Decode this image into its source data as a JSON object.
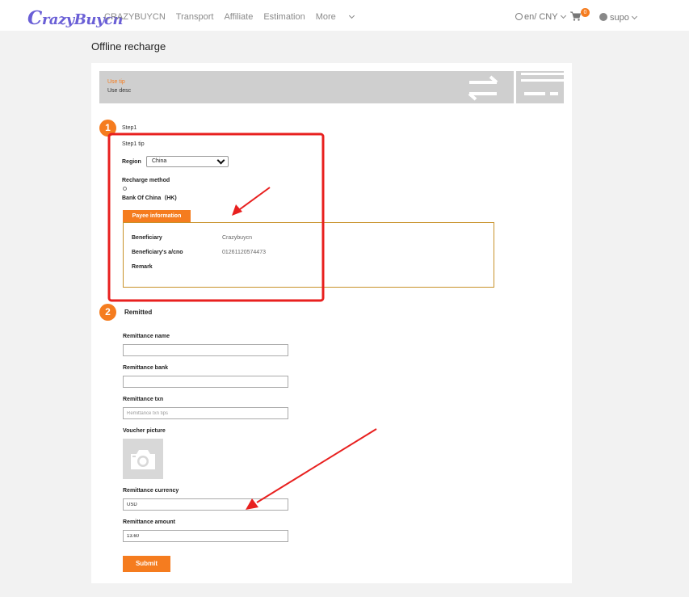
{
  "header": {
    "logo_initial": "C",
    "logo_rest": "razyBuycn",
    "nav": [
      "CRAZYBUYCN",
      "Transport",
      "Affiliate",
      "Estimation",
      "More"
    ],
    "lang": "en/ CNY",
    "cart_count": "0",
    "user": "supo"
  },
  "page_title": "Offline recharge",
  "tip": {
    "title": "Use tip",
    "desc": "Use desc"
  },
  "step1": {
    "number": "1",
    "label": "Step1",
    "tip": "Step1 tip",
    "region_label": "Region",
    "region_value": "China",
    "method_label": "Recharge method",
    "method_option": "Bank Of China（HK)",
    "payee_tab": "Payee information",
    "payee": {
      "beneficiary_label": "Beneficiary",
      "beneficiary_value": "Crazybuycn",
      "account_label": "Beneficiary's a/cno",
      "account_value": "01261120574473",
      "remark_label": "Remark"
    }
  },
  "step2": {
    "number": "2",
    "label": "Remitted",
    "name_label": "Remittance name",
    "bank_label": "Remittance bank",
    "txn_label": "Remittance txn",
    "txn_placeholder": "Remittance txn tips",
    "voucher_label": "Voucher picture",
    "currency_label": "Remittance currency",
    "currency_value": "USD",
    "amount_label": "Remittance amount",
    "amount_value": "13.60",
    "submit_label": "Submit"
  },
  "colors": {
    "accent": "#f57c1f",
    "annotation": "#e8201f",
    "logo": "#6a5fd6"
  }
}
